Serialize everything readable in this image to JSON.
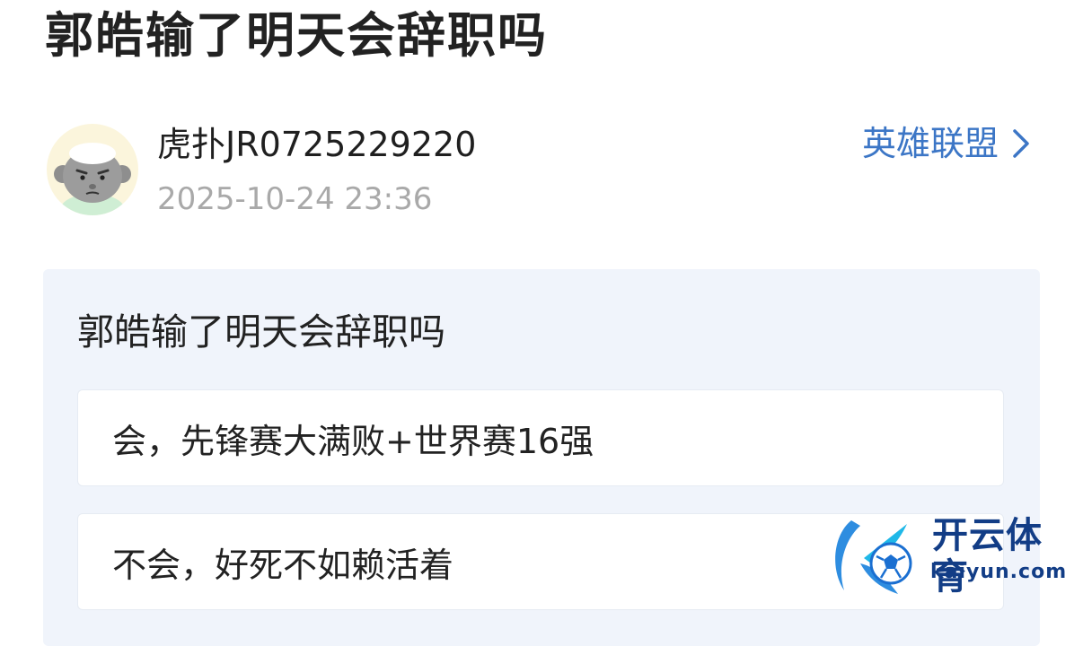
{
  "post": {
    "title": "郭皓输了明天会辞职吗",
    "author": "虎扑JR0725229220",
    "time": "2025-10-24 23:36",
    "forum_label": "英雄联盟"
  },
  "poll": {
    "question": "郭皓输了明天会辞职吗",
    "options": [
      {
        "label": "会，先锋赛大满败+世界赛16强"
      },
      {
        "label": "不会，好死不如赖活着"
      }
    ]
  },
  "watermark": {
    "brand": "开云体育",
    "url": "kaiyun.com"
  },
  "colors": {
    "link": "#3c76c6",
    "muted": "#a9a9a9",
    "poll_bg": "#f0f4fb",
    "watermark": "#123d86"
  },
  "icons": {
    "avatar": "cartoon-avatar",
    "forum_link": "chevron-right-icon"
  }
}
